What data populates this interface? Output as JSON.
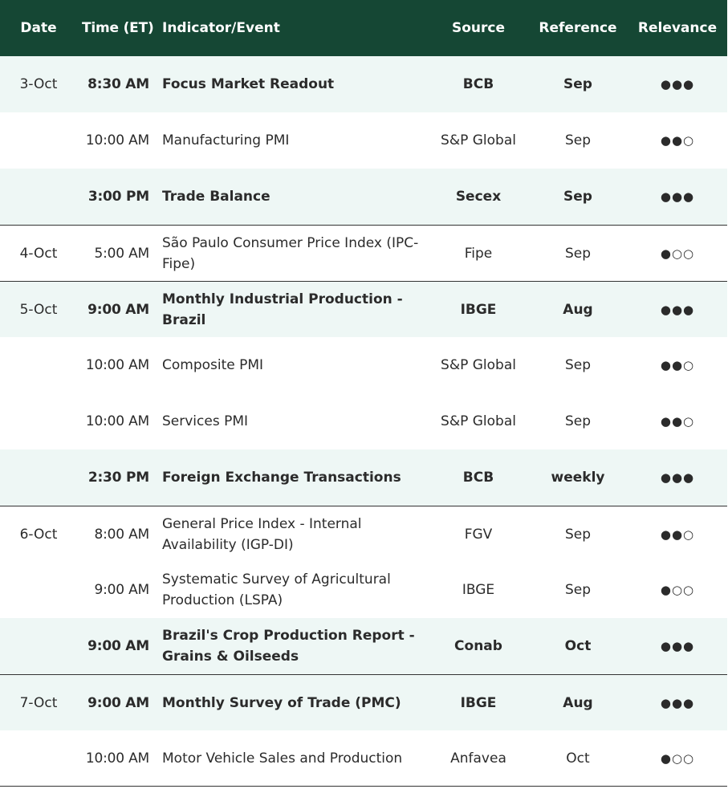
{
  "header": {
    "date": "Date",
    "time": "Time (ET)",
    "indicator": "Indicator/Event",
    "source": "Source",
    "reference": "Reference",
    "relevance": "Relevance"
  },
  "colors": {
    "header_bg": "#154734",
    "highlight_bg": "#eef7f5"
  },
  "rows": [
    {
      "date": "3-Oct",
      "time": "8:30 AM",
      "indicator": "Focus Market Readout",
      "source": "BCB",
      "reference": "Sep",
      "relevance": "●●●"
    },
    {
      "date": "",
      "time": "10:00 AM",
      "indicator": "Manufacturing PMI",
      "source": "S&P Global",
      "reference": "Sep",
      "relevance": "●●○"
    },
    {
      "date": "",
      "time": "3:00 PM",
      "indicator": "Trade Balance",
      "source": "Secex",
      "reference": "Sep",
      "relevance": "●●●"
    },
    {
      "date": "4-Oct",
      "time": "5:00 AM",
      "indicator": "São Paulo Consumer Price Index (IPC-Fipe)",
      "source": "Fipe",
      "reference": "Sep",
      "relevance": "●○○"
    },
    {
      "date": "5-Oct",
      "time": "9:00 AM",
      "indicator": "Monthly Industrial Production - Brazil",
      "source": "IBGE",
      "reference": "Aug",
      "relevance": "●●●"
    },
    {
      "date": "",
      "time": "10:00 AM",
      "indicator": "Composite PMI",
      "source": "S&P Global",
      "reference": "Sep",
      "relevance": "●●○"
    },
    {
      "date": "",
      "time": "10:00 AM",
      "indicator": "Services PMI",
      "source": "S&P Global",
      "reference": "Sep",
      "relevance": "●●○"
    },
    {
      "date": "",
      "time": "2:30 PM",
      "indicator": "Foreign Exchange Transactions",
      "source": "BCB",
      "reference": "weekly",
      "relevance": "●●●"
    },
    {
      "date": "6-Oct",
      "time": "8:00 AM",
      "indicator": "General Price Index - Internal Availability (IGP-DI)",
      "source": "FGV",
      "reference": "Sep",
      "relevance": "●●○"
    },
    {
      "date": "",
      "time": "9:00 AM",
      "indicator": "Systematic Survey of Agricultural Production (LSPA)",
      "source": "IBGE",
      "reference": "Sep",
      "relevance": "●○○"
    },
    {
      "date": "",
      "time": "9:00 AM",
      "indicator": "Brazil's Crop Production Report - Grains & Oilseeds",
      "source": "Conab",
      "reference": "Oct",
      "relevance": "●●●"
    },
    {
      "date": "7-Oct",
      "time": "9:00 AM",
      "indicator": "Monthly Survey of Trade (PMC)",
      "source": "IBGE",
      "reference": "Aug",
      "relevance": "●●●"
    },
    {
      "date": "",
      "time": "10:00 AM",
      "indicator": "Motor Vehicle Sales and Production",
      "source": "Anfavea",
      "reference": "Oct",
      "relevance": "●○○"
    }
  ]
}
